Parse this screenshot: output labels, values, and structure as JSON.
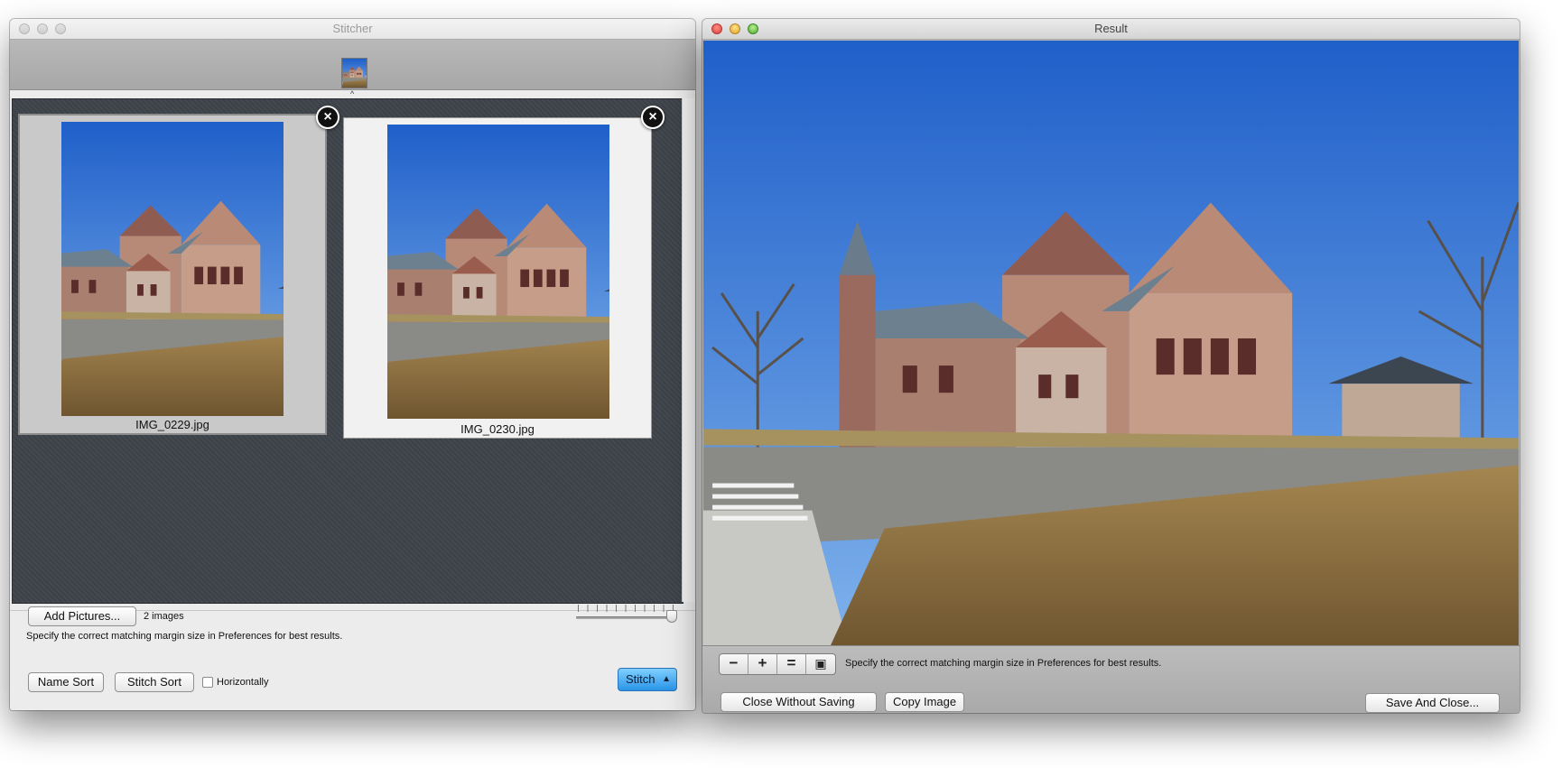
{
  "stitcher": {
    "title": "Stitcher",
    "images": [
      {
        "filename": "IMG_0229.jpg",
        "selected": true
      },
      {
        "filename": "IMG_0230.jpg",
        "selected": false
      }
    ],
    "add_pictures_label": "Add Pictures...",
    "image_count": "2 images",
    "hint": "Specify the correct matching margin size in Preferences for best results.",
    "name_sort_label": "Name Sort",
    "stitch_sort_label": "Stitch Sort",
    "horizontally_label": "Horizontally",
    "stitch_label": "Stitch",
    "remove_icon": "close-circle-icon"
  },
  "result": {
    "title": "Result",
    "zoom_out_glyph": "−",
    "zoom_in_glyph": "+",
    "actual_size_glyph": "=",
    "fit_glyph": "▣",
    "hint": "Specify the correct matching margin size in Preferences for best results.",
    "close_without_saving_label": "Close Without Saving",
    "copy_image_label": "Copy Image",
    "save_and_close_label": "Save And Close..."
  },
  "colors": {
    "sky": "#2f74d6",
    "grass": "#9a7c45",
    "stitch_button": "#2a94e8",
    "grid_background": "#3e434a"
  }
}
